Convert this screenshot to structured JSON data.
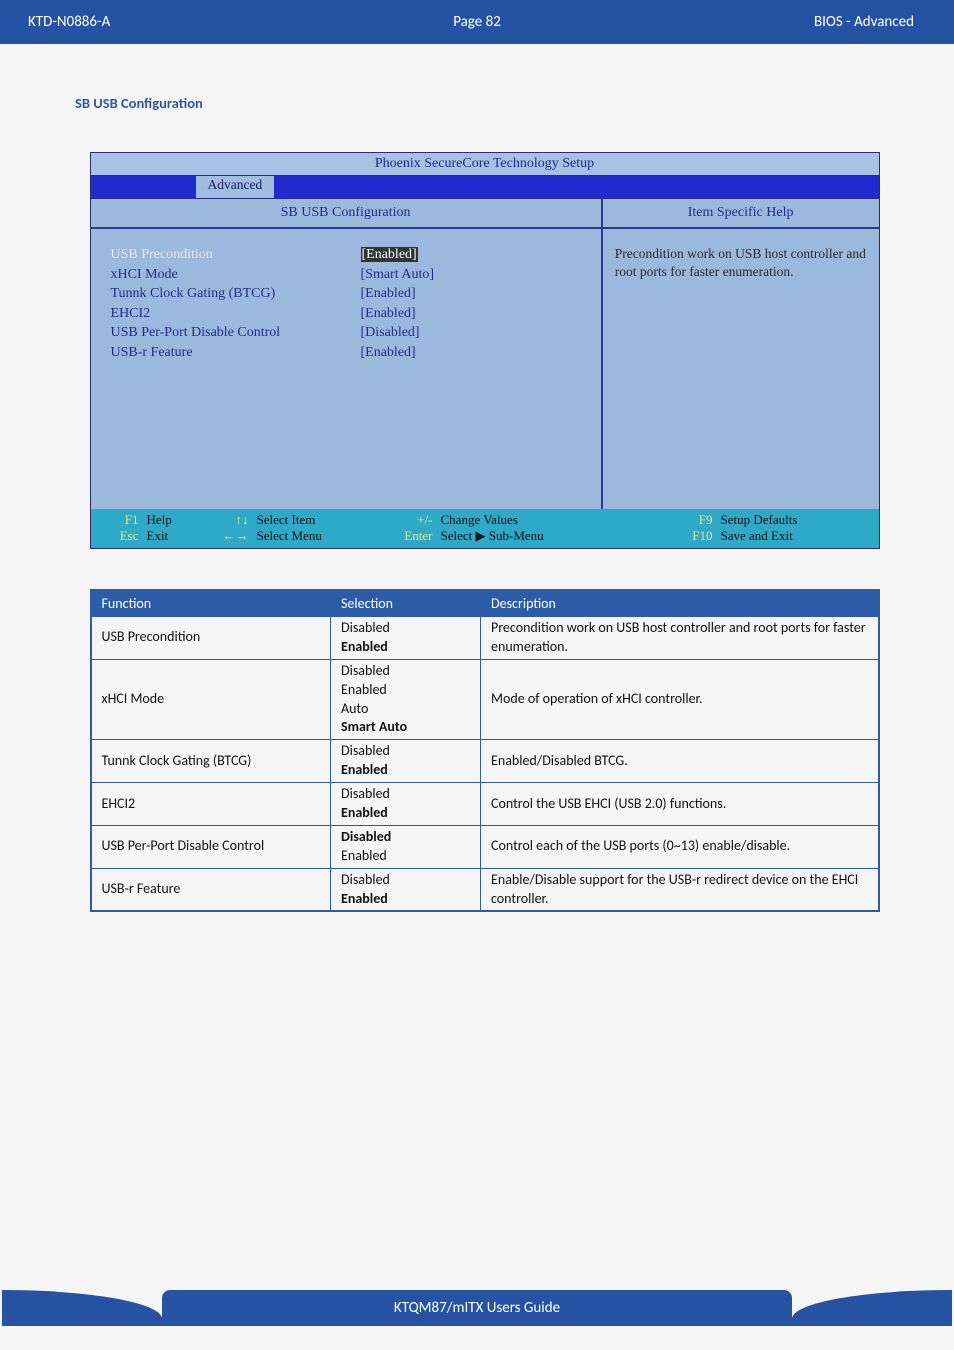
{
  "header": {
    "doc_id": "KTD-N0886-A",
    "page_label": "Page 82",
    "section": "BIOS  - Advanced"
  },
  "section_title": "SB USB Configuration",
  "bios": {
    "window_title": "Phoenix SecureCore Technology Setup",
    "tab": "Advanced",
    "left_title": "SB USB Configuration",
    "help_title": "Item Specific Help",
    "help_body": "Precondition work on USB host controller and root ports for faster enumeration.",
    "items": [
      {
        "label": "USB Precondition",
        "value": "[Enabled]",
        "selected": true
      },
      {
        "label": "xHCI Mode",
        "value": "[Smart Auto]",
        "selected": false
      },
      {
        "label": "Tunnk Clock Gating (BTCG)",
        "value": "[Enabled]",
        "selected": false
      },
      {
        "label": "EHCI2",
        "value": "[Enabled]",
        "selected": false
      },
      {
        "label": "USB Per-Port Disable Control",
        "value": "[Disabled]",
        "selected": false
      },
      {
        "label": "USB-r Feature",
        "value": "[Enabled]",
        "selected": false
      }
    ],
    "footer": {
      "row1": [
        {
          "key": "F1",
          "action": "Help"
        },
        {
          "key": "↑↓",
          "action": "Select Item"
        },
        {
          "key": "+/-",
          "action": "Change Values"
        },
        {
          "key": "F9",
          "action": "Setup Defaults"
        }
      ],
      "row2": [
        {
          "key": "Esc",
          "action": "Exit"
        },
        {
          "key": "←→",
          "action": "Select Menu"
        },
        {
          "key": "Enter",
          "action": "Select ▶ Sub-Menu"
        },
        {
          "key": "F10",
          "action": "Save and Exit"
        }
      ]
    }
  },
  "table": {
    "headers": [
      "Function",
      "Selection",
      "Description"
    ],
    "rows": [
      {
        "function": "USB Precondition",
        "selection_lines": [
          {
            "text": "Disabled",
            "bold": false
          },
          {
            "text": "Enabled",
            "bold": true
          }
        ],
        "description": "Precondition work on USB host controller and root ports for faster enumeration."
      },
      {
        "function": "xHCI Mode",
        "selection_lines": [
          {
            "text": "Disabled",
            "bold": false
          },
          {
            "text": "Enabled",
            "bold": false
          },
          {
            "text": "Auto",
            "bold": false
          },
          {
            "text": "Smart Auto",
            "bold": true
          }
        ],
        "description": "Mode of operation of xHCI controller."
      },
      {
        "function": "Tunnk Clock Gating (BTCG)",
        "selection_lines": [
          {
            "text": "Disabled",
            "bold": false
          },
          {
            "text": "Enabled",
            "bold": true
          }
        ],
        "description": "Enabled/Disabled BTCG."
      },
      {
        "function": "EHCI2",
        "selection_lines": [
          {
            "text": "Disabled",
            "bold": false
          },
          {
            "text": "Enabled",
            "bold": true
          }
        ],
        "description": "Control the USB EHCI (USB 2.0) functions."
      },
      {
        "function": "USB Per-Port Disable Control",
        "selection_lines": [
          {
            "text": "Disabled",
            "bold": true
          },
          {
            "text": "Enabled",
            "bold": false
          }
        ],
        "description": "Control each of the USB ports (0~13) enable/disable."
      },
      {
        "function": "USB-r Feature",
        "selection_lines": [
          {
            "text": "Disabled",
            "bold": false
          },
          {
            "text": "Enabled",
            "bold": true
          }
        ],
        "description": "Enable/Disable support for the USB-r redirect device on the EHCI controller."
      }
    ]
  },
  "footer_text": "KTQM87/mITX Users Guide"
}
